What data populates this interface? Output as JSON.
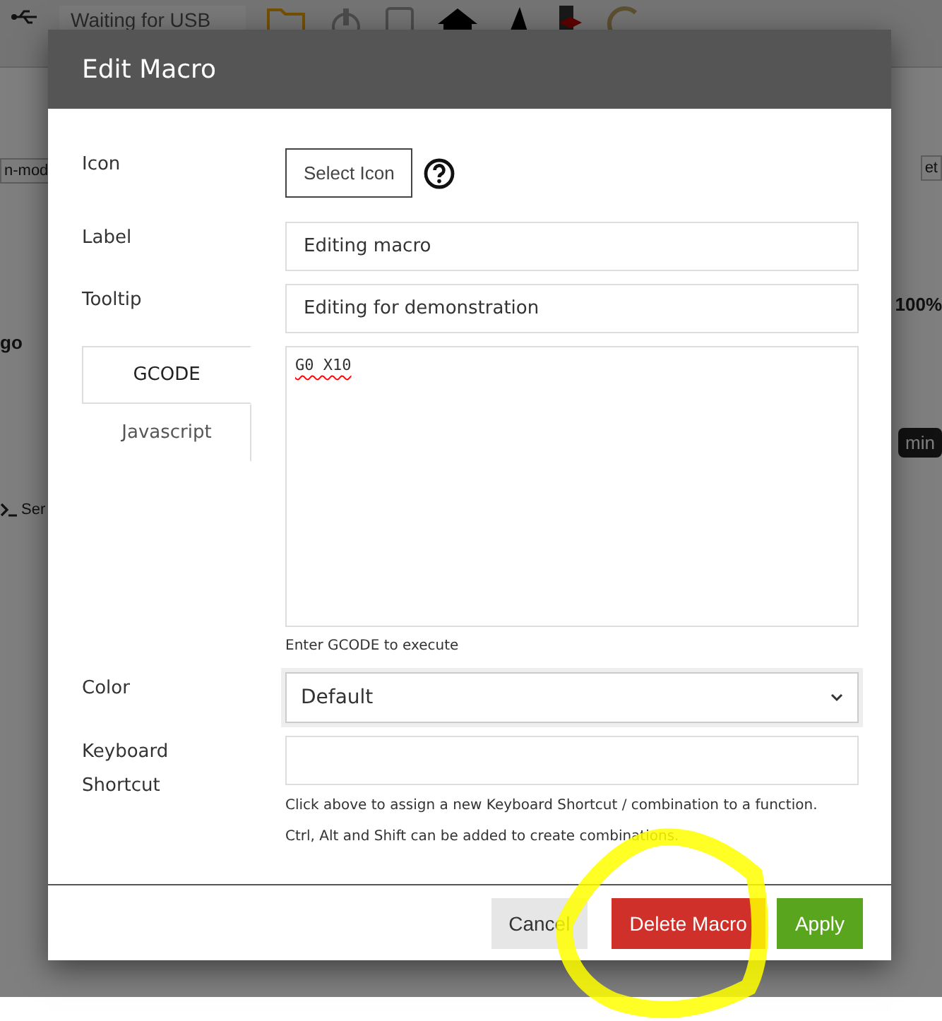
{
  "background": {
    "connection": "Waiting for USB",
    "left_items": [
      {
        "kind": "button",
        "text": "n-mod"
      },
      {
        "kind": "text",
        "text": "go"
      },
      {
        "kind": "console",
        "text": "Ser"
      }
    ],
    "right_items": [
      {
        "kind": "button",
        "text": "et"
      },
      {
        "kind": "text",
        "text": "100%"
      },
      {
        "kind": "badge",
        "text": "min"
      }
    ]
  },
  "dialog": {
    "title": "Edit Macro",
    "icon": {
      "label": "Icon",
      "button": "Select Icon"
    },
    "label": {
      "label": "Label",
      "value": "Editing macro"
    },
    "tooltip": {
      "label": "Tooltip",
      "value": "Editing for demonstration"
    },
    "code": {
      "tabs": [
        {
          "label": "GCODE",
          "selected": true
        },
        {
          "label": "Javascript",
          "selected": false
        }
      ],
      "value": "G0 X10",
      "hint": "Enter GCODE to execute"
    },
    "color": {
      "label": "Color",
      "value": "Default"
    },
    "shortcut": {
      "label": "Keyboard Shortcut",
      "hints": [
        "Click above to assign a new Keyboard Shortcut / combination to a function.",
        "Ctrl, Alt and Shift can be added to create combinations."
      ]
    },
    "buttons": [
      {
        "kind": "cancel",
        "text": "Cancel"
      },
      {
        "kind": "danger",
        "text": "Delete Macro"
      },
      {
        "kind": "primary",
        "text": "Apply"
      }
    ]
  }
}
